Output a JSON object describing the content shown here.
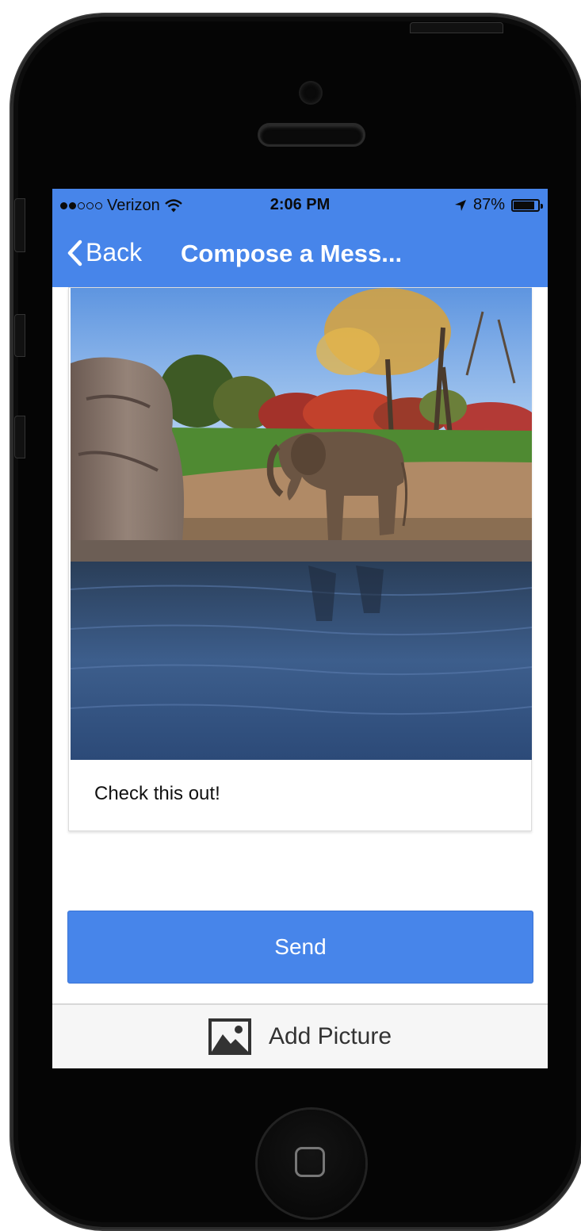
{
  "status_bar": {
    "carrier": "Verizon",
    "time": "2:06 PM",
    "battery": "87%",
    "battery_level": 0.87,
    "signal_bars_filled": 2,
    "signal_bars_total": 5
  },
  "nav": {
    "back_label": "Back",
    "title": "Compose a Mess..."
  },
  "message": {
    "text": "Check this out!",
    "photo_icon": "elephant-photo"
  },
  "actions": {
    "send_label": "Send",
    "add_picture_label": "Add Picture"
  },
  "colors": {
    "accent": "#4785ea",
    "bottom_bar": "#f6f6f6"
  },
  "icons": [
    "wifi-icon",
    "location-arrow-icon",
    "battery-icon",
    "back-chevron-icon",
    "image-icon"
  ]
}
